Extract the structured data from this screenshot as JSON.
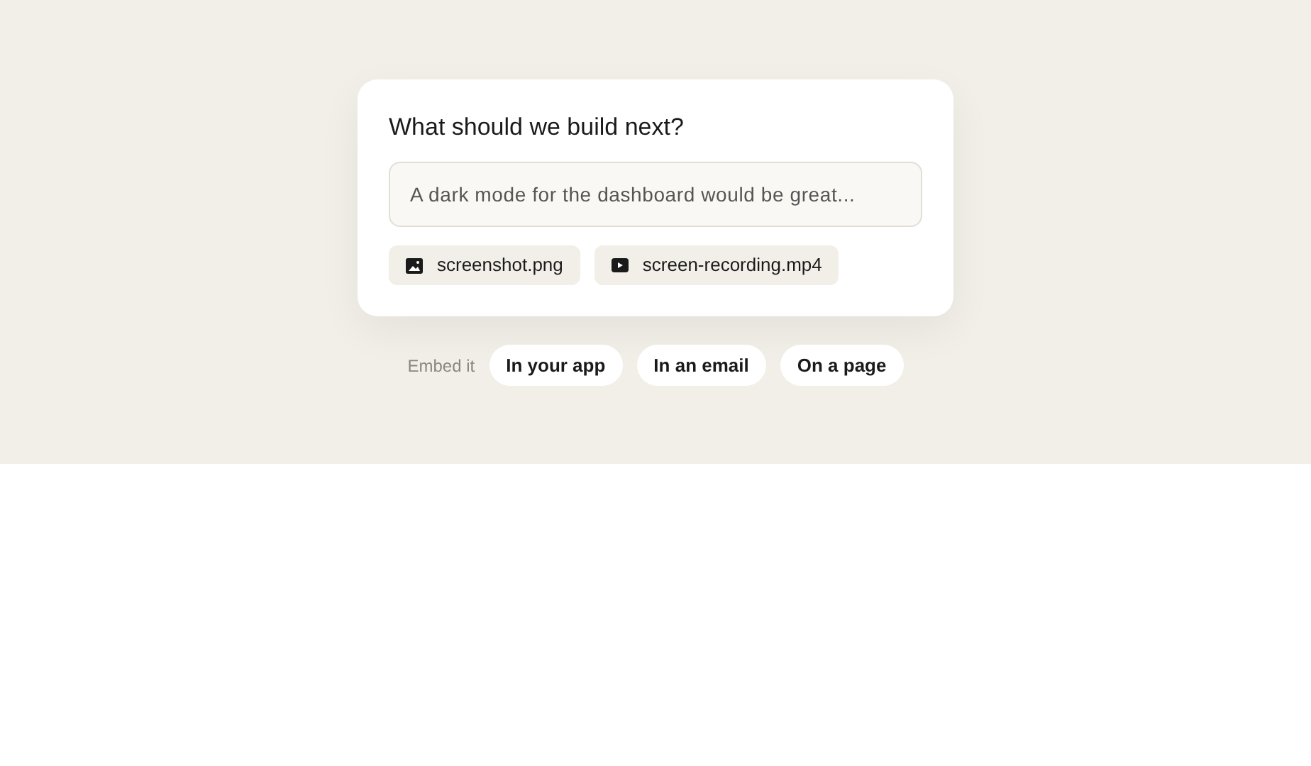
{
  "card": {
    "title": "What should we build next?",
    "input": {
      "placeholder": "A dark mode for the dashboard would be great..."
    },
    "attachments": [
      {
        "kind": "image",
        "name": "screenshot.png"
      },
      {
        "kind": "video",
        "name": "screen-recording.mp4"
      }
    ]
  },
  "embed": {
    "label": "Embed it",
    "options": [
      "In your app",
      "In an email",
      "On a page"
    ]
  }
}
